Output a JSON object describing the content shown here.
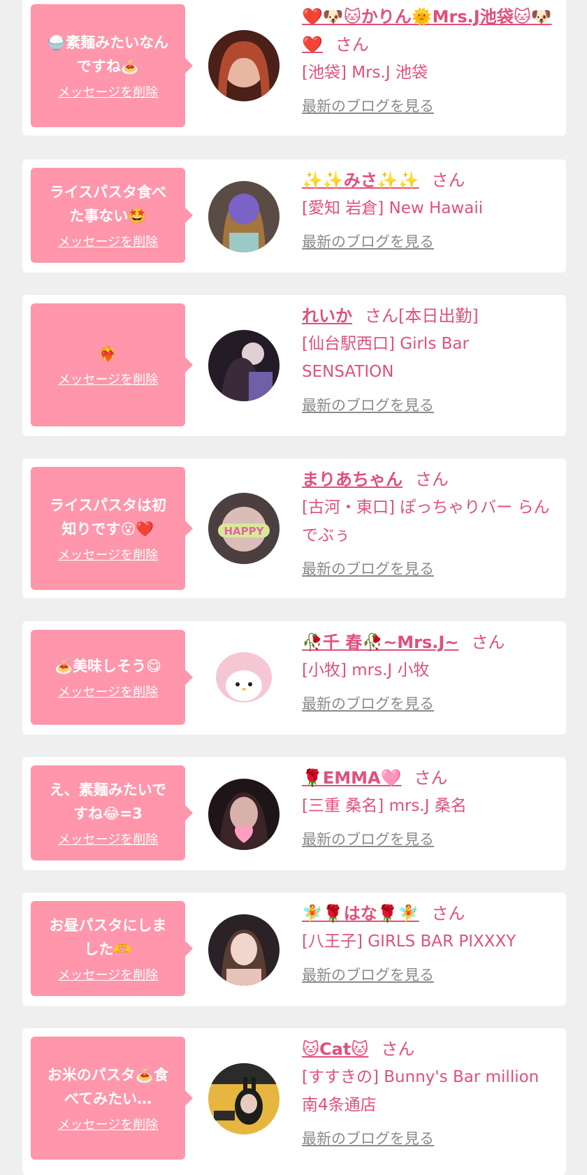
{
  "items": [
    {
      "message": "🍚素麺みたいなん\nですね🍝",
      "delete_label": "メッセージを削除",
      "name": "❤️🐶🐱かりん🌞Mrs.J池袋🐱🐶❤️",
      "san": "さん",
      "shop": "[池袋] Mrs.J 池袋",
      "blog_label": "最新のブログを見る",
      "avatar_color": "#6b2f24"
    },
    {
      "message": "ライスパスタ食べ\nた事ない🤩",
      "delete_label": "メッセージを削除",
      "name": "✨✨みさ✨✨",
      "san": "さん",
      "shop": "[愛知 岩倉] New Hawaii",
      "blog_label": "最新のブログを見る",
      "avatar_color": "#8a6a7a"
    },
    {
      "message": "❤️‍🔥",
      "delete_label": "メッセージを削除",
      "name": "れいか",
      "san": "さん[本日出勤]",
      "shop": "[仙台駅西口] Girls Bar SENSATION",
      "blog_label": "最新のブログを見る",
      "avatar_color": "#2a2230"
    },
    {
      "message": "ライスパスタは初\n知りです😮❤️",
      "delete_label": "メッセージを削除",
      "name": "まりあちゃん",
      "san": "さん",
      "shop": "[古河・東口] ぽっちゃりバー らんでぶぅ",
      "blog_label": "最新のブログを見る",
      "avatar_color": "#6e5a5a"
    },
    {
      "message": "🍝美味しそう😋",
      "delete_label": "メッセージを削除",
      "name": "🥀千 春🥀~Mrs.J~",
      "san": "さん",
      "shop": "[小牧] mrs.J 小牧",
      "blog_label": "最新のブログを見る",
      "avatar_color": "#f4d3dc"
    },
    {
      "message": "え、素麺みたいで\nすね😂=3",
      "delete_label": "メッセージを削除",
      "name": "🌹EMMA🩷",
      "san": "さん",
      "shop": "[三重 桑名] mrs.J 桑名",
      "blog_label": "最新のブログを見る",
      "avatar_color": "#2b1d22"
    },
    {
      "message": "お昼パスタにしま\nした🫶",
      "delete_label": "メッセージを削除",
      "name": "🧚🌹はな🌹🧚",
      "san": "さん",
      "shop": "[八王子] GIRLS BAR PIXXXY",
      "blog_label": "最新のブログを見る",
      "avatar_color": "#caa59b"
    },
    {
      "message": "お米のパスタ🍝食\nべてみたい…",
      "delete_label": "メッセージを削除",
      "name": "🐱Cat🐱",
      "san": "さん",
      "shop": "[すすきの] Bunny's Bar million 南4条通店",
      "blog_label": "最新のブログを見る",
      "avatar_color": "#e6b640"
    }
  ]
}
